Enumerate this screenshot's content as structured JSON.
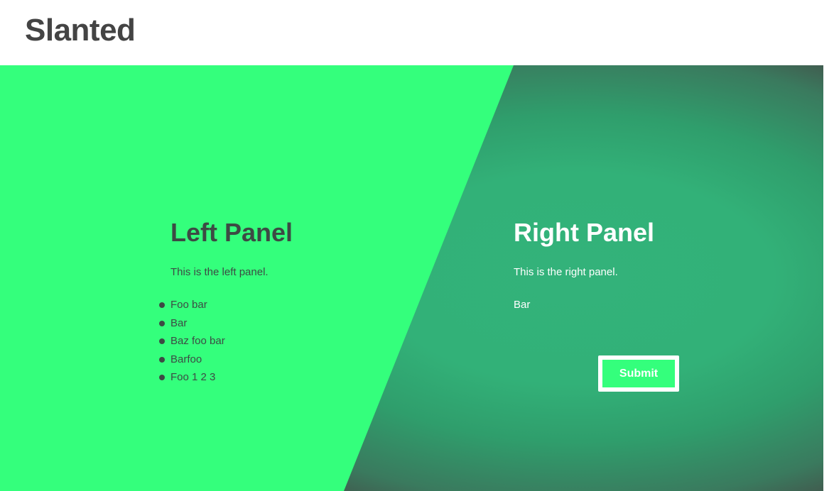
{
  "site": {
    "title": "Slanted"
  },
  "left_panel": {
    "title": "Left Panel",
    "description": "This is the left panel.",
    "items": [
      "Foo bar",
      "Bar",
      "Baz foo bar",
      "Barfoo",
      "Foo 1 2 3"
    ]
  },
  "right_panel": {
    "title": "Right Panel",
    "description": "This is the right panel.",
    "extra": "Bar",
    "submit_label": "Submit"
  },
  "colors": {
    "accent_green": "#34ff7c",
    "dark_green": "#33b27a",
    "text_dark": "#3d4a44",
    "title_gray": "#444444"
  }
}
